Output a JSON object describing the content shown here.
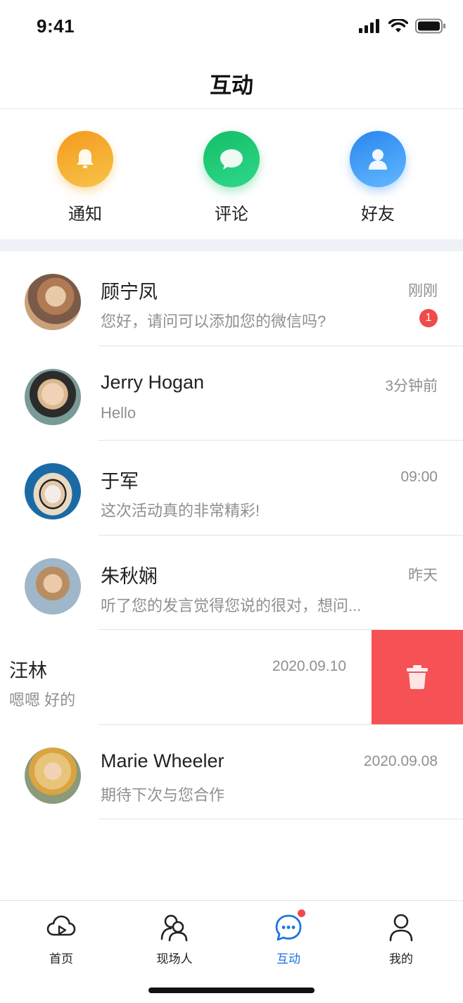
{
  "status_bar": {
    "time": "9:41"
  },
  "header": {
    "title": "互动"
  },
  "quick_actions": [
    {
      "label": "通知",
      "icon": "bell-icon",
      "color_from": "#f5a623",
      "color_to": "#f7c244"
    },
    {
      "label": "评论",
      "icon": "comment-icon",
      "color_from": "#1bc46e",
      "color_to": "#2fd88a"
    },
    {
      "label": "好友",
      "icon": "user-icon",
      "color_from": "#2d8cf0",
      "color_to": "#5fb3ff"
    }
  ],
  "chats": [
    {
      "name": "顾宁凤",
      "message": "您好，请问可以添加您的微信吗?",
      "time": "刚刚",
      "unread": "1",
      "avatar_colors": [
        "#c9a07a",
        "#6b4a3a"
      ]
    },
    {
      "name": "Jerry Hogan",
      "message": "Hello",
      "time": "3分钟前",
      "avatar_colors": [
        "#7a9a98",
        "#e5c6a8"
      ]
    },
    {
      "name": "于军",
      "message": "这次活动真的非常精彩!",
      "time": "09:00",
      "avatar_colors": [
        "#1b6fa8",
        "#e8d8c0"
      ]
    },
    {
      "name": "朱秋娴",
      "message": "听了您的发言觉得您说的很对，想问...",
      "time": "昨天",
      "avatar_colors": [
        "#9fb7c8",
        "#d8b08a"
      ]
    },
    {
      "name": "汪林",
      "message": "嗯嗯 好的",
      "time": "2020.09.10",
      "swiped": true
    },
    {
      "name": "Marie Wheeler",
      "message": "期待下次与您合作",
      "time": "2020.09.08",
      "avatar_colors": [
        "#8a9a7a",
        "#e0b060"
      ]
    }
  ],
  "swipe_action": {
    "icon": "trash-icon",
    "color": "#f65155"
  },
  "tabs": [
    {
      "label": "首页",
      "icon": "home-cloud-icon",
      "active": false
    },
    {
      "label": "现场人",
      "icon": "people-icon",
      "active": false
    },
    {
      "label": "互动",
      "icon": "chat-bubble-icon",
      "active": true,
      "has_dot": true
    },
    {
      "label": "我的",
      "icon": "profile-icon",
      "active": false
    }
  ],
  "accent_color": "#1f73e0"
}
